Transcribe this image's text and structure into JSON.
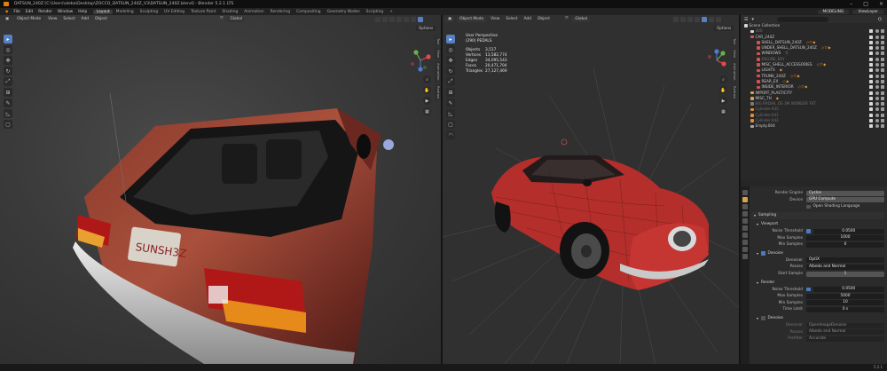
{
  "window": {
    "title": "DATSUN_240Z [C:\\Users\\aleba\\Desktop\\ZOCCO_DATSUN_240Z_V3\\DATSUN_240Z.blend] - Blender 5.2.1 LTS"
  },
  "menu": {
    "items": [
      "File",
      "Edit",
      "Render",
      "Window",
      "Help"
    ],
    "workspaces": [
      "Layout",
      "Modeling",
      "Sculpting",
      "UV Editing",
      "Texture Paint",
      "Shading",
      "Animation",
      "Rendering",
      "Compositing",
      "Geometry Nodes",
      "Scripting"
    ],
    "active_workspace": "Layout",
    "add_tab": "+",
    "scene_name": "MODELING",
    "view_layer": "ViewLayer"
  },
  "viewport_left": {
    "mode": "Object Mode",
    "menus": [
      "View",
      "Select",
      "Add",
      "Object"
    ],
    "transform": "Global",
    "options": "Options"
  },
  "viewport_right": {
    "mode": "Object Mode",
    "menus": [
      "View",
      "Select",
      "Add",
      "Object"
    ],
    "transform": "Global",
    "options": "Options",
    "overlay": {
      "view_name": "User Perspective",
      "collection": "(290) PEDALS",
      "stats": [
        {
          "label": "Objects",
          "value": "3,517"
        },
        {
          "label": "Vertices",
          "value": "13,582,774"
        },
        {
          "label": "Edges",
          "value": "34,095,543"
        },
        {
          "label": "Faces",
          "value": "20,471,704"
        },
        {
          "label": "Triangles",
          "value": "27,127,469"
        }
      ]
    },
    "side_tabs": [
      "Tool",
      "View",
      "Animation",
      "Redraw"
    ]
  },
  "left_side_tabs": [
    "Tool",
    "View",
    "Animation",
    "Redraw"
  ],
  "car": {
    "plate": "SUNSH3Z"
  },
  "outliner": {
    "root": "Scene Collection",
    "items": [
      {
        "name": "360",
        "indent": 1,
        "color": "#d6d6d6",
        "mods": "",
        "dim": true
      },
      {
        "name": "CAR_240Z",
        "indent": 1,
        "color": "#d4524e",
        "mods": "",
        "dim": false
      },
      {
        "name": "SHELL_DATSUN_240Z",
        "indent": 2,
        "color": "#d4524e",
        "mods": "◇▽◆",
        "dim": false
      },
      {
        "name": "UNDER_SHELL_DATSUN_240Z",
        "indent": 2,
        "color": "#d4524e",
        "mods": "◇▽◆",
        "dim": false
      },
      {
        "name": "WINDOWS",
        "indent": 2,
        "color": "#d4524e",
        "mods": "▽",
        "dim": false
      },
      {
        "name": "ENGINE_BAY",
        "indent": 2,
        "color": "#d4524e",
        "mods": "",
        "dim": true
      },
      {
        "name": "MISC_SHELL_ACCESSORIES",
        "indent": 2,
        "color": "#d4524e",
        "mods": "◇▽◆",
        "dim": false
      },
      {
        "name": "LIGHTS",
        "indent": 2,
        "color": "#d4524e",
        "mods": "◆",
        "dim": false
      },
      {
        "name": "TRUNK_240Z",
        "indent": 2,
        "color": "#d4524e",
        "mods": "◇▽◆",
        "dim": false
      },
      {
        "name": "REAR_EX",
        "indent": 2,
        "color": "#d4524e",
        "mods": "◇◆",
        "dim": false
      },
      {
        "name": "INSIDE_INTERIOR",
        "indent": 2,
        "color": "#d4524e",
        "mods": "◇▽◆",
        "dim": false
      },
      {
        "name": "IMPORT_PLASTICITY",
        "indent": 1,
        "color": "#d9a24a",
        "mods": "",
        "dim": false
      },
      {
        "name": "MISC_TH",
        "indent": 1,
        "color": "#d9a24a",
        "mods": "◆",
        "dim": false
      },
      {
        "name": "BIG RADIAL DS 3M WONDER YET",
        "indent": 1,
        "color": "#7a7a7a",
        "mods": "",
        "dim": true
      },
      {
        "name": "Cylinder.035",
        "indent": 1,
        "color": "#e08a3a",
        "mods": "",
        "dim": true
      },
      {
        "name": "Cylinder.041",
        "indent": 1,
        "color": "#e08a3a",
        "mods": "",
        "dim": true
      },
      {
        "name": "Cylinder.042",
        "indent": 1,
        "color": "#e08a3a",
        "mods": "",
        "dim": true
      },
      {
        "name": "Empty.004",
        "indent": 1,
        "color": "#a8a8a8",
        "mods": "",
        "dim": false
      }
    ]
  },
  "properties": {
    "render_engine_label": "Render Engine",
    "render_engine": "Cycles",
    "device_label": "Device",
    "device": "GPU Compute",
    "osl_label": "Open Shading Language",
    "sampling": "Sampling",
    "viewport_section": "Viewport",
    "vp_noise_label": "Noise Threshold",
    "vp_noise": "0.0500",
    "vp_max_label": "Max Samples",
    "vp_max": "1000",
    "vp_min_label": "Min Samples",
    "vp_min": "0",
    "denoise_label": "Denoise",
    "denoiser_label": "Denoiser",
    "denoiser": "OptiX",
    "passes_label": "Passes",
    "passes": "Albedo and Normal",
    "start_label": "Start Sample",
    "start": "1",
    "render_section": "Render",
    "r_noise_label": "Noise Threshold",
    "r_noise": "0.0500",
    "r_max_label": "Max Samples",
    "r_max": "5000",
    "r_min_label": "Min Samples",
    "r_min": "10",
    "r_time_label": "Time Limit",
    "r_time": "0 s",
    "r_denoise_label": "Denoise",
    "r_denoiser_label": "Denoiser",
    "r_denoiser": "OpenImageDenoise",
    "r_passes_label": "Passes",
    "r_passes": "Albedo and Normal",
    "r_prefilter_label": "Prefilter",
    "r_prefilter": "Accurate"
  },
  "status": {
    "version": "5.2.1"
  },
  "colors": {
    "accent": "#5680c2",
    "car_paint": "#b0402f",
    "outliner_selected": "#334a6b"
  }
}
